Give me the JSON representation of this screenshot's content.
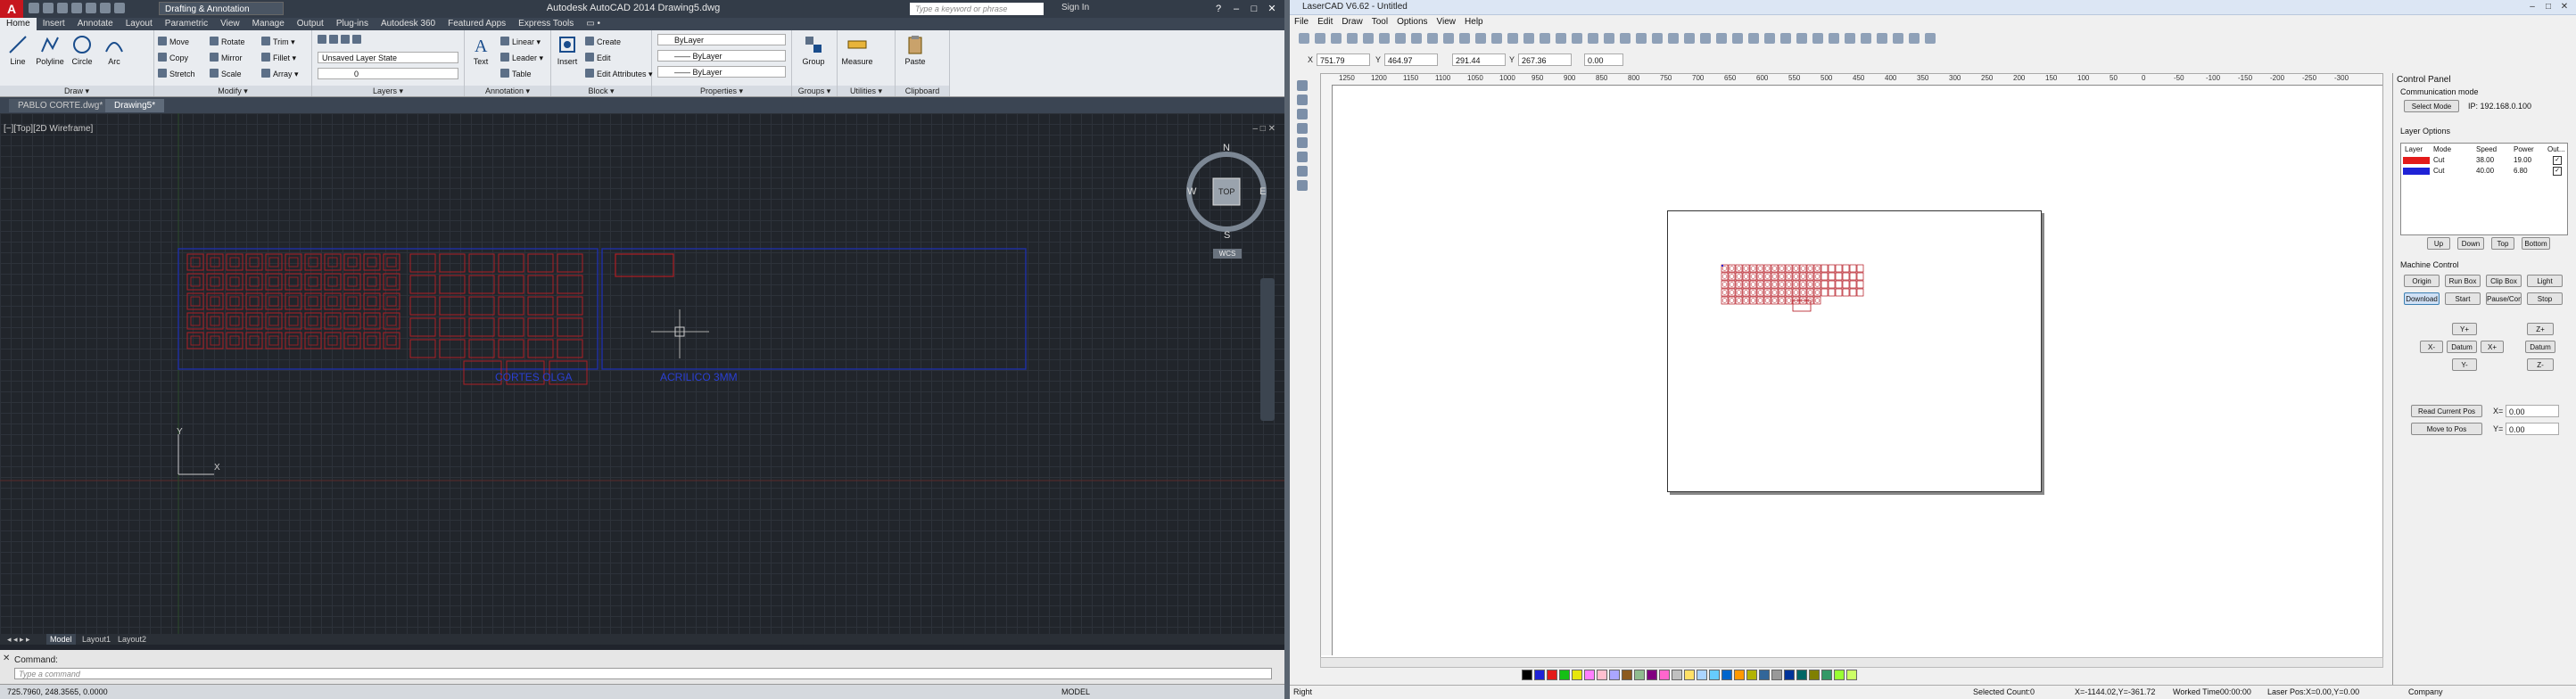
{
  "autocad": {
    "title": "Autodesk AutoCAD 2014    Drawing5.dwg",
    "workspace": "Drafting & Annotation",
    "search_placeholder": "Type a keyword or phrase",
    "sign_in": "Sign In",
    "ribbon_tabs": [
      "Home",
      "Insert",
      "Annotate",
      "Layout",
      "Parametric",
      "View",
      "Manage",
      "Output",
      "Plug-ins",
      "Autodesk 360",
      "Featured Apps",
      "Express Tools",
      "▭ •"
    ],
    "panels": {
      "draw": {
        "title": "Draw ▾",
        "line": "Line",
        "polyline": "Polyline",
        "circle": "Circle",
        "arc": "Arc"
      },
      "modify": {
        "title": "Modify ▾",
        "move": "Move",
        "rotate": "Rotate",
        "trim": "Trim ▾",
        "copy": "Copy",
        "mirror": "Mirror",
        "fillet": "Fillet ▾",
        "stretch": "Stretch",
        "scale": "Scale",
        "array": "Array ▾"
      },
      "layers": {
        "title": "Layers ▾",
        "state": "Unsaved Layer State",
        "current": "0"
      },
      "annotation": {
        "title": "Annotation ▾",
        "text": "Text",
        "linear": "Linear ▾",
        "leader": "Leader ▾",
        "table": "Table"
      },
      "block": {
        "title": "Block ▾",
        "insert": "Insert",
        "create": "Create",
        "edit": "Edit",
        "edit_attributes": "Edit Attributes ▾"
      },
      "properties": {
        "title": "Properties ▾",
        "color": "ByLayer",
        "linetype": "—— ByLayer",
        "lineweight": "—— ByLayer"
      },
      "groups": {
        "title": "Groups ▾",
        "group": "Group"
      },
      "utilities": {
        "title": "Utilities ▾",
        "measure": "Measure"
      },
      "clipboard": {
        "title": "Clipboard",
        "paste": "Paste"
      }
    },
    "doc_tabs": [
      "PABLO CORTE.dwg*",
      "Drawing5*"
    ],
    "viewport_label": "[−][Top][2D Wireframe]",
    "viewcube": {
      "n": "N",
      "s": "S",
      "e": "E",
      "w": "W",
      "top": "TOP",
      "wcs": "WCS"
    },
    "canvas_texts": {
      "left": "CORTES OLGA",
      "right": "ACRILICO 3MM"
    },
    "layout_tabs": [
      "Model",
      "Layout1",
      "Layout2"
    ],
    "command_history": "Command:",
    "command_placeholder": "Type a command",
    "coords": "725.7960, 248.3565, 0.0000",
    "status_model": "MODEL",
    "colors": {
      "accent": "#c7161e",
      "geometry": "#b01e24",
      "frame": "#1f2f9e",
      "label": "#2a3fd4"
    }
  },
  "lasercad": {
    "title": "LaserCAD V6.62 - Untitled",
    "menu": [
      "File",
      "Edit",
      "Draw",
      "Tool",
      "Options",
      "View",
      "Help"
    ],
    "fields": {
      "x": "751.79",
      "y": "464.97",
      "w": "291.44",
      "h": "267.36",
      "angle": "0.00"
    },
    "labels": {
      "x": "X",
      "y": "Y",
      "w": "",
      "h": "Y"
    },
    "ruler_top": [
      "1250",
      "1200",
      "1150",
      "1100",
      "1050",
      "1000",
      "950",
      "900",
      "850",
      "800",
      "750",
      "700",
      "650",
      "600",
      "550",
      "500",
      "450",
      "400",
      "350",
      "300",
      "250",
      "200",
      "150",
      "100",
      "50",
      "0",
      "-50",
      "-100",
      "-150",
      "-200",
      "-250",
      "-300"
    ],
    "panel": {
      "title": "Control Panel",
      "comm_mode": "Communication mode",
      "select_mode": "Select Mode",
      "ip": "IP: 192.168.0.100",
      "layer_options": "Layer Options",
      "headers": [
        "Layer",
        "Mode",
        "Speed",
        "Power",
        "Out..."
      ],
      "layers": [
        {
          "color": "#e31a1a",
          "mode": "Cut",
          "speed": "38.00",
          "power": "19.00",
          "out": "✓"
        },
        {
          "color": "#1f22d6",
          "mode": "Cut",
          "speed": "40.00",
          "power": "6.80",
          "out": "✓"
        }
      ],
      "order_buttons": [
        "Up",
        "Down",
        "Top",
        "Bottom"
      ],
      "machine_control": "Machine Control",
      "mc_row1": [
        "Origin",
        "Run Box",
        "Clip Box",
        "Light"
      ],
      "mc_row2": [
        "Download",
        "Start",
        "Pause/Continue",
        "Stop"
      ],
      "jog": {
        "yplus": "Y+",
        "xminus": "X-",
        "datum": "Datum",
        "xplus": "X+",
        "yminus": "Y-",
        "zplus": "Z+",
        "zdatum": "Datum",
        "zminus": "Z-"
      },
      "read_pos": "Read Current Pos",
      "move_to": "Move to Pos",
      "x_label": "X=",
      "x_val": "0.00",
      "y_label": "Y=",
      "y_val": "0.00"
    },
    "palette": [
      "#000000",
      "#1f22d6",
      "#e31a1a",
      "#15c015",
      "#e6e60c",
      "#ff7fff",
      "#ffbfcf",
      "#aaa6ff",
      "#8c5a1e",
      "#8fbc8f",
      "#800080",
      "#ff66cc",
      "#c0c0c0",
      "#ffe066",
      "#aad4ff",
      "#66ccff",
      "#0066cc",
      "#ff9900",
      "#b3b300",
      "#336699",
      "#999999",
      "#003399",
      "#006666",
      "#808000",
      "#339966",
      "#99ff33",
      "#ccff66"
    ],
    "status": {
      "mode": "Right",
      "selected": "Selected Count:0",
      "cursor": "X=-1144.02,Y=-361.72",
      "time": "Worked Time00:00:00",
      "laser": "Laser Pos:X=0.00,Y=0.00",
      "company": "Company"
    },
    "colors": {
      "red": "#b3101a",
      "blue": "#1f22d6"
    }
  }
}
